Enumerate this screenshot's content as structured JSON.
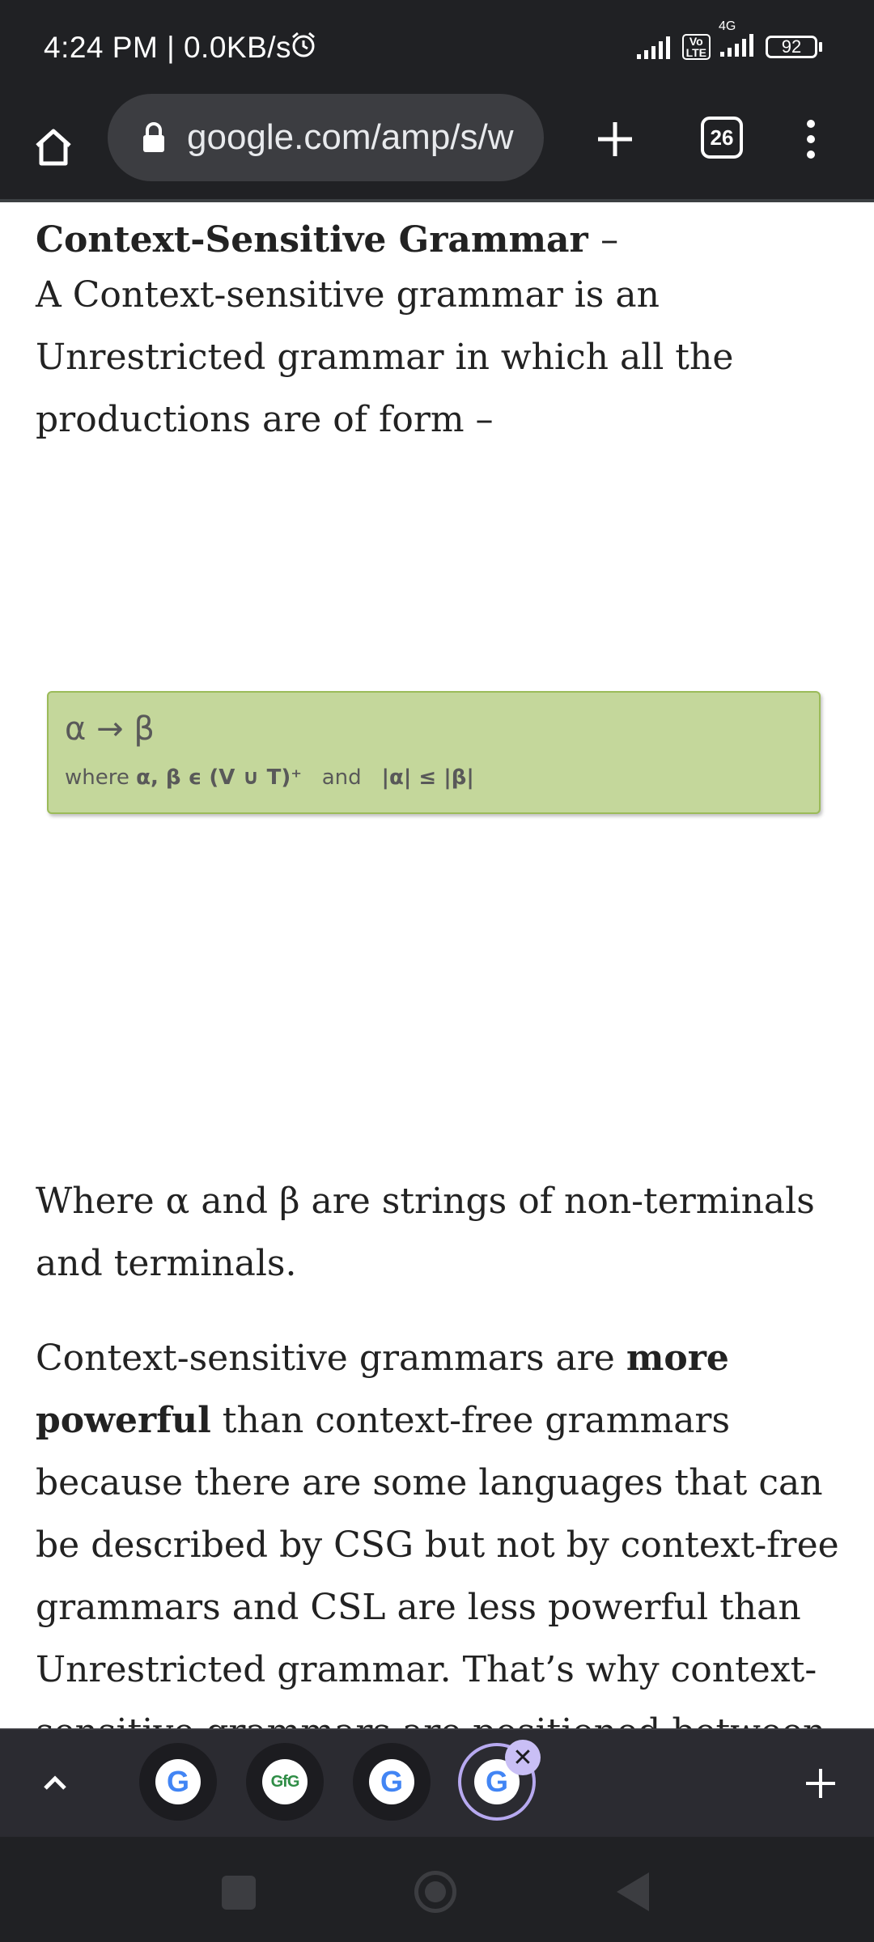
{
  "status_bar": {
    "time": "4:24 PM | 0.0KB/s",
    "volte": "Vo\nLTE",
    "network": "4G",
    "battery": "92"
  },
  "toolbar": {
    "url": "google.com/amp/s/w",
    "tab_count": "26"
  },
  "article": {
    "heading": "Context-Sensitive Grammar",
    "heading_dash": "–",
    "intro": "A Context-sensitive grammar is an Unrestricted grammar in which all the productions are of form –",
    "formula": {
      "rule": "α → β",
      "cond_where": "where",
      "cond_set": "α, β ϵ (V ∪ T)⁺",
      "cond_and": "and",
      "cond_len": "|α| ≤ |β|"
    },
    "p2": "Where α and β are strings of non-terminals and terminals.",
    "p3_before": "Context-sensitive grammars are ",
    "p3_bold": "more powerful",
    "p3_after": " than context-free grammars because there are some languages that can be described by CSG but not by context-free grammars and CSL are less powerful than Unrestricted grammar. That’s why context-sensitive grammars are positioned between"
  },
  "tab_strip": {
    "tabs": [
      {
        "icon": "google-icon",
        "glyph": "G"
      },
      {
        "icon": "geeksforgeeks-icon",
        "glyph": "GfG"
      },
      {
        "icon": "google-icon",
        "glyph": "G"
      },
      {
        "icon": "google-icon",
        "glyph": "G",
        "active": true
      }
    ],
    "close_glyph": "✕"
  },
  "colors": {
    "chrome_bg": "#202124",
    "formula_bg": "#c4d79b",
    "active_tab_ring": "#b7a9f0"
  }
}
